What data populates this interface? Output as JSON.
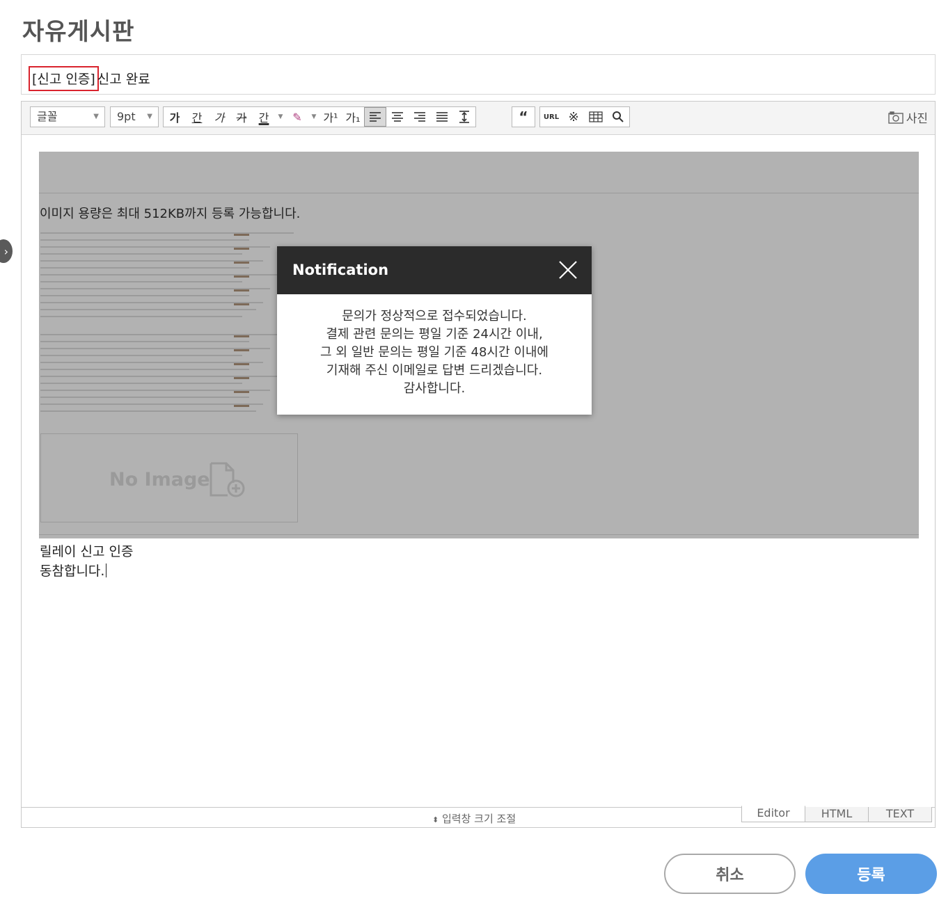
{
  "page_title": "자유게시판",
  "post": {
    "title_prefix": "[신고 인증]",
    "title_rest": "신고 완료"
  },
  "toolbar": {
    "font_select": "글꼴",
    "size_select": "9pt",
    "photo_label": "사진",
    "buttons": [
      "bold",
      "underline",
      "italic",
      "strikethrough",
      "font-color",
      "highlight",
      "superscript",
      "subscript",
      "align-left",
      "align-center",
      "align-right",
      "justify",
      "line-height",
      "quote",
      "url",
      "special-char",
      "table",
      "find"
    ]
  },
  "content": {
    "image_caption": "이미지 용량은 최대 512KB까지 등록 가능합니다.",
    "no_image_text": "No Image",
    "body_line_1": "릴레이 신고 인증",
    "body_line_2": "동참합니다."
  },
  "editor_footer": {
    "resize_label": "입력창 크기 조절",
    "tabs": [
      "Editor",
      "HTML",
      "TEXT"
    ],
    "active_tab": "Editor"
  },
  "actions": {
    "cancel_label": "취소",
    "submit_label": "등록"
  },
  "modal": {
    "title": "Notification",
    "lines": [
      "문의가 정상적으로 접수되었습니다.",
      "결제 관련 문의는 평일 기준 24시간 이내,",
      "그 외 일반 문의는 평일 기준 48시간 이내에",
      "기재해 주신 이메일로 답변 드리겠습니다.",
      "감사합니다."
    ]
  },
  "colors": {
    "submit_button": "#5b9ee6",
    "modal_header": "#2b2b2b",
    "title_highlight_border": "#d9232d",
    "overlay_gray": "#b2b2b2"
  }
}
